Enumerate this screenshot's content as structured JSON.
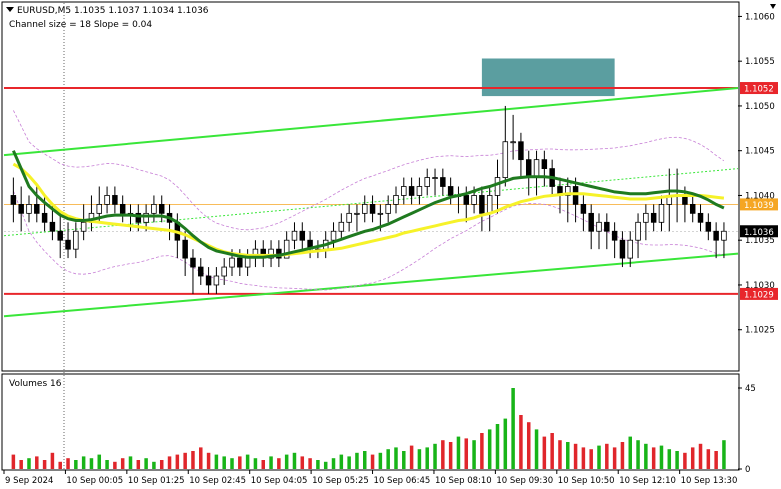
{
  "header": {
    "symbol_line": "EURUSD,M5  1.1035 1.1037 1.1034 1.1036",
    "channel_line": "Channel size = 18 Slope = 0.04",
    "volume_label": "Volumes 16"
  },
  "price_axis": {
    "ticks": [
      "1.1060",
      "1.1055",
      "1.1050",
      "1.1045",
      "1.1040",
      "1.1035",
      "1.1030",
      "1.1025"
    ],
    "tick_values": [
      1.106,
      1.1055,
      1.105,
      1.1045,
      1.104,
      1.1035,
      1.103,
      1.1025
    ]
  },
  "volume_axis": {
    "ticks": [
      "45",
      "0"
    ],
    "tick_values": [
      45,
      0
    ]
  },
  "time_axis": {
    "labels": [
      "9 Sep 2024",
      "10 Sep 00:05",
      "10 Sep 01:25",
      "10 Sep 02:45",
      "10 Sep 04:05",
      "10 Sep 05:25",
      "10 Sep 06:45",
      "10 Sep 08:10",
      "10 Sep 09:30",
      "10 Sep 10:50",
      "10 Sep 12:10",
      "10 Sep 13:30"
    ]
  },
  "price_markers": [
    {
      "label": "1.1052",
      "value": 1.1052,
      "color": "#e8262b"
    },
    {
      "label": "1.1039",
      "value": 1.1039,
      "color": "#f5a623"
    },
    {
      "label": "1.1036",
      "value": 1.1036,
      "color": "#000000"
    },
    {
      "label": "1.1029",
      "value": 1.1029,
      "color": "#e8262b"
    }
  ],
  "colors": {
    "resistance": "#e8262b",
    "support": "#e8262b",
    "channel": "#39e639",
    "ma_slow": "#f6f229",
    "ma_fast": "#1f7a1f",
    "bollinger": "#c77fd6",
    "candle": "#000000",
    "volume_up": "#18b418",
    "volume_down": "#e0262b",
    "zone": "#5b9ea0"
  },
  "chart_data": {
    "type": "candlestick",
    "symbol": "EURUSD",
    "timeframe": "M5",
    "ylim": [
      1.10205,
      1.10615
    ],
    "horizontal_levels": [
      1.1052,
      1.1029
    ],
    "channel": {
      "upper": {
        "start": 1.10445,
        "end": 1.1052
      },
      "lower": {
        "start": 1.10265,
        "end": 1.10335
      },
      "mid": {
        "start": 1.10355,
        "end": 1.1043
      }
    },
    "zone": {
      "from_index": 60,
      "to_index": 77,
      "low": 1.10511,
      "high": 1.10553
    },
    "last": 1.1036,
    "opens": [
      1.104,
      1.1039,
      1.1038,
      1.1039,
      1.1038,
      1.1037,
      1.1036,
      1.1035,
      1.1034,
      1.1036,
      1.1037,
      1.1038,
      1.1039,
      1.104,
      1.1039,
      1.1038,
      1.1038,
      1.1037,
      1.1038,
      1.1039,
      1.1038,
      1.1037,
      1.1035,
      1.1033,
      1.1032,
      1.1031,
      1.103,
      1.1031,
      1.1032,
      1.1033,
      1.1032,
      1.1033,
      1.1034,
      1.1033,
      1.1034,
      1.1033,
      1.1035,
      1.1036,
      1.1035,
      1.1034,
      1.1034,
      1.1035,
      1.1036,
      1.1037,
      1.1038,
      1.1038,
      1.1039,
      1.1038,
      1.1038,
      1.1039,
      1.104,
      1.1041,
      1.104,
      1.1041,
      1.1042,
      1.1042,
      1.1041,
      1.104,
      1.104,
      1.1039,
      1.104,
      1.1038,
      1.104,
      1.1042,
      1.1046,
      1.1046,
      1.1044,
      1.1042,
      1.1044,
      1.1043,
      1.1041,
      1.104,
      1.1041,
      1.1039,
      1.1038,
      1.1036,
      1.1037,
      1.1036,
      1.1035,
      1.1033,
      1.1035,
      1.1037,
      1.1038,
      1.1037,
      1.1039,
      1.104,
      1.104,
      1.1039,
      1.1038,
      1.1037,
      1.1036,
      1.1035
    ],
    "closes": [
      1.1039,
      1.1038,
      1.1039,
      1.1038,
      1.1037,
      1.1036,
      1.1035,
      1.1034,
      1.1036,
      1.1037,
      1.1038,
      1.1039,
      1.104,
      1.1039,
      1.1038,
      1.1038,
      1.1037,
      1.1038,
      1.1039,
      1.1038,
      1.1037,
      1.1035,
      1.1033,
      1.1032,
      1.1031,
      1.103,
      1.1031,
      1.1032,
      1.1033,
      1.1032,
      1.1033,
      1.1034,
      1.1033,
      1.1034,
      1.1033,
      1.1035,
      1.1036,
      1.1035,
      1.1034,
      1.1034,
      1.1035,
      1.1036,
      1.1037,
      1.1038,
      1.1038,
      1.1039,
      1.1038,
      1.1038,
      1.1039,
      1.104,
      1.1041,
      1.104,
      1.1041,
      1.1042,
      1.1042,
      1.1041,
      1.104,
      1.104,
      1.1039,
      1.104,
      1.1038,
      1.104,
      1.1042,
      1.1046,
      1.1046,
      1.1044,
      1.1042,
      1.1044,
      1.1043,
      1.1041,
      1.104,
      1.1041,
      1.1039,
      1.1038,
      1.1036,
      1.1037,
      1.1036,
      1.1035,
      1.1033,
      1.1035,
      1.1037,
      1.1038,
      1.1037,
      1.1039,
      1.104,
      1.104,
      1.1039,
      1.1038,
      1.1037,
      1.1036,
      1.1035,
      1.1036
    ],
    "highs": [
      1.1042,
      1.1041,
      1.104,
      1.1041,
      1.104,
      1.1039,
      1.1038,
      1.1037,
      1.1037,
      1.1039,
      1.104,
      1.1041,
      1.1041,
      1.1041,
      1.104,
      1.1039,
      1.1039,
      1.1039,
      1.104,
      1.104,
      1.1039,
      1.1038,
      1.1036,
      1.1034,
      1.1033,
      1.1032,
      1.1032,
      1.1033,
      1.1034,
      1.1034,
      1.1034,
      1.1035,
      1.1035,
      1.1035,
      1.1035,
      1.1036,
      1.1037,
      1.1037,
      1.1036,
      1.1035,
      1.1036,
      1.1037,
      1.1038,
      1.1039,
      1.1039,
      1.104,
      1.104,
      1.1039,
      1.104,
      1.1041,
      1.1042,
      1.1042,
      1.1042,
      1.1043,
      1.1043,
      1.1043,
      1.1042,
      1.1041,
      1.1041,
      1.1041,
      1.1041,
      1.1041,
      1.1044,
      1.105,
      1.1049,
      1.1047,
      1.1045,
      1.1045,
      1.1045,
      1.1044,
      1.1042,
      1.1042,
      1.1042,
      1.104,
      1.1039,
      1.1038,
      1.1038,
      1.1037,
      1.1036,
      1.1036,
      1.1038,
      1.1039,
      1.1039,
      1.104,
      1.1043,
      1.1043,
      1.1041,
      1.104,
      1.1039,
      1.1038,
      1.1037,
      1.1037
    ],
    "lows": [
      1.1037,
      1.1036,
      1.1037,
      1.1037,
      1.1036,
      1.1035,
      1.1033,
      1.1033,
      1.1033,
      1.1035,
      1.1036,
      1.1037,
      1.1038,
      1.1038,
      1.1037,
      1.1036,
      1.1036,
      1.1036,
      1.1037,
      1.1037,
      1.1035,
      1.1033,
      1.1031,
      1.1029,
      1.103,
      1.1029,
      1.1029,
      1.103,
      1.1031,
      1.1031,
      1.1031,
      1.1032,
      1.1032,
      1.1032,
      1.1032,
      1.1033,
      1.1034,
      1.1034,
      1.1033,
      1.1033,
      1.1033,
      1.1034,
      1.1035,
      1.1036,
      1.1036,
      1.1037,
      1.1037,
      1.1036,
      1.1037,
      1.1038,
      1.1039,
      1.1039,
      1.1039,
      1.104,
      1.104,
      1.104,
      1.1039,
      1.1038,
      1.1037,
      1.1038,
      1.1036,
      1.1036,
      1.1038,
      1.1041,
      1.1044,
      1.1042,
      1.104,
      1.104,
      1.1041,
      1.104,
      1.1038,
      1.1037,
      1.1037,
      1.1036,
      1.1034,
      1.1034,
      1.1034,
      1.1033,
      1.1032,
      1.1032,
      1.1033,
      1.1035,
      1.1036,
      1.1036,
      1.1036,
      1.1037,
      1.1037,
      1.1037,
      1.1036,
      1.1035,
      1.1033,
      1.1033
    ],
    "ma_slow": [
      1.10435,
      1.1043,
      1.10422,
      1.10412,
      1.104,
      1.1039,
      1.10382,
      1.10377,
      1.10374,
      1.10372,
      1.10371,
      1.1037,
      1.10369,
      1.10368,
      1.10367,
      1.10366,
      1.10365,
      1.10364,
      1.10363,
      1.10362,
      1.10361,
      1.10359,
      1.10356,
      1.10352,
      1.10348,
      1.10344,
      1.1034,
      1.10337,
      1.10335,
      1.10334,
      1.10333,
      1.10333,
      1.10333,
      1.10333,
      1.10333,
      1.10334,
      1.10335,
      1.10336,
      1.10337,
      1.10338,
      1.10339,
      1.1034,
      1.10341,
      1.10343,
      1.10345,
      1.10347,
      1.10349,
      1.10351,
      1.10353,
      1.10355,
      1.10358,
      1.1036,
      1.10362,
      1.10364,
      1.10366,
      1.10368,
      1.1037,
      1.10372,
      1.10373,
      1.10375,
      1.10378,
      1.1038,
      1.10383,
      1.10387,
      1.1039,
      1.10393,
      1.10395,
      1.10397,
      1.10399,
      1.104,
      1.10401,
      1.10402,
      1.10402,
      1.10402,
      1.10401,
      1.104,
      1.10399,
      1.10398,
      1.10397,
      1.10396,
      1.10396,
      1.10396,
      1.10397,
      1.10398,
      1.10399,
      1.104,
      1.104,
      1.104,
      1.104,
      1.10399,
      1.10398,
      1.10397
    ],
    "ma_fast": [
      1.1045,
      1.1043,
      1.1041,
      1.104,
      1.10392,
      1.10385,
      1.10378,
      1.10374,
      1.10372,
      1.10372,
      1.10373,
      1.10375,
      1.10377,
      1.10378,
      1.10378,
      1.10378,
      1.10377,
      1.10377,
      1.10377,
      1.10377,
      1.10375,
      1.1037,
      1.10363,
      1.10355,
      1.10348,
      1.10342,
      1.10338,
      1.10336,
      1.10334,
      1.10332,
      1.10331,
      1.10331,
      1.10331,
      1.10332,
      1.10333,
      1.10335,
      1.10337,
      1.10339,
      1.10341,
      1.10343,
      1.10345,
      1.10348,
      1.10351,
      1.10354,
      1.10357,
      1.1036,
      1.10362,
      1.10365,
      1.10368,
      1.10372,
      1.10376,
      1.1038,
      1.10384,
      1.10388,
      1.10392,
      1.10395,
      1.10398,
      1.104,
      1.10402,
      1.10405,
      1.10408,
      1.1041,
      1.10413,
      1.10416,
      1.10419,
      1.1042,
      1.10421,
      1.10421,
      1.10421,
      1.1042,
      1.10418,
      1.10416,
      1.10414,
      1.10412,
      1.1041,
      1.10408,
      1.10406,
      1.10404,
      1.10403,
      1.10402,
      1.10402,
      1.10402,
      1.10403,
      1.10404,
      1.10405,
      1.10405,
      1.10404,
      1.10402,
      1.10399,
      1.10395,
      1.1039,
      1.10386
    ],
    "volumes": [
      8,
      5,
      6,
      7,
      5,
      9,
      4,
      6,
      5,
      7,
      6,
      8,
      5,
      4,
      6,
      7,
      5,
      6,
      4,
      5,
      7,
      8,
      9,
      10,
      12,
      9,
      8,
      7,
      6,
      7,
      8,
      6,
      5,
      7,
      6,
      8,
      9,
      7,
      6,
      5,
      4,
      6,
      8,
      7,
      9,
      10,
      8,
      9,
      11,
      12,
      10,
      13,
      11,
      12,
      14,
      16,
      15,
      18,
      17,
      16,
      20,
      22,
      25,
      28,
      45,
      30,
      26,
      22,
      18,
      20,
      16,
      15,
      14,
      12,
      11,
      13,
      14,
      12,
      15,
      18,
      16,
      14,
      12,
      13,
      11,
      10,
      9,
      12,
      14,
      11,
      10,
      16
    ]
  }
}
